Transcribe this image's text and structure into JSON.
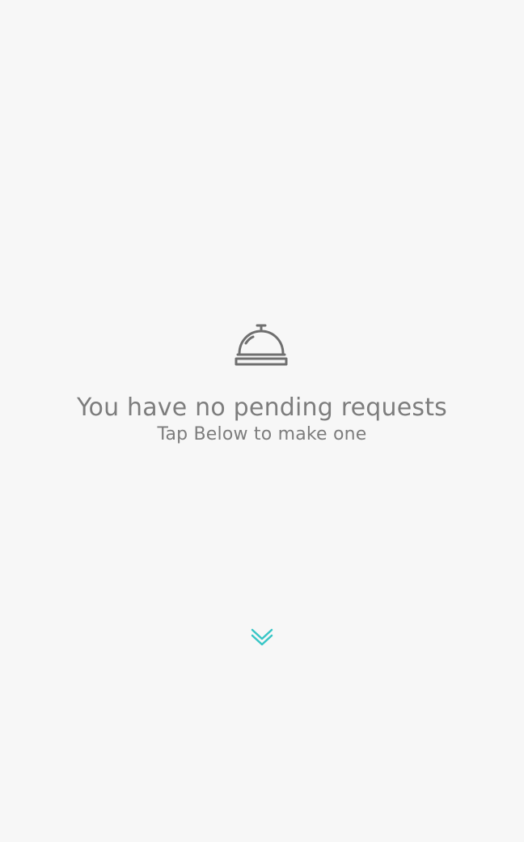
{
  "empty_state": {
    "icon": "service-bell-icon",
    "title": "You have no pending requests",
    "subtitle": "Tap Below to make one"
  },
  "action": {
    "icon": "double-chevron-down-icon",
    "color": "#38c6c6"
  },
  "colors": {
    "background": "#f7f7f7",
    "text": "#7d7d7d",
    "icon": "#6f6f6f"
  }
}
